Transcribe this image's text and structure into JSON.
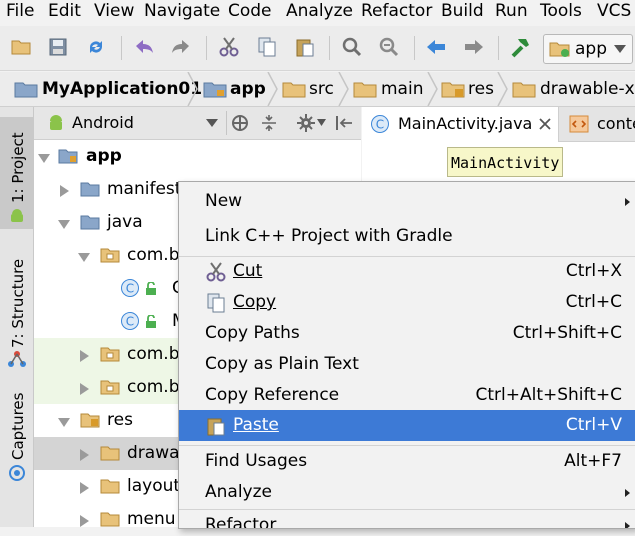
{
  "menubar": {
    "items": [
      "File",
      "Edit",
      "View",
      "Navigate",
      "Code",
      "Analyze",
      "Refactor",
      "Build",
      "Run",
      "Tools",
      "VCS"
    ]
  },
  "toolbar": {
    "icons": [
      "open-folder-icon",
      "save-icon",
      "sync-icon",
      "undo-icon",
      "redo-icon",
      "cut-icon",
      "copy-icon",
      "paste-icon",
      "find-icon",
      "replace-icon",
      "back-icon",
      "forward-icon",
      "build-hammer-icon"
    ],
    "run_config": "app"
  },
  "navbar": {
    "crumbs": [
      "MyApplication01",
      "app",
      "src",
      "main",
      "res",
      "drawable-xh"
    ]
  },
  "tool_strip": {
    "project": "1: Project",
    "structure": "7: Structure",
    "captures": "Captures"
  },
  "project_panel": {
    "view": "Android",
    "tree": [
      {
        "label": "app",
        "depth": 0,
        "state": "open",
        "icon": "module"
      },
      {
        "label": "manifests",
        "depth": 1,
        "state": "closed",
        "icon": "folder"
      },
      {
        "label": "java",
        "depth": 1,
        "state": "open",
        "icon": "folder"
      },
      {
        "label": "com.b",
        "depth": 2,
        "state": "open",
        "icon": "package"
      },
      {
        "label": "C",
        "depth": 3,
        "state": "none",
        "icon": "class"
      },
      {
        "label": "M",
        "depth": 3,
        "state": "none",
        "icon": "class"
      },
      {
        "label": "com.b",
        "depth": 2,
        "state": "closed",
        "icon": "package"
      },
      {
        "label": "com.b",
        "depth": 2,
        "state": "closed",
        "icon": "package"
      },
      {
        "label": "res",
        "depth": 1,
        "state": "open",
        "icon": "res-folder"
      },
      {
        "label": "drawal",
        "depth": 2,
        "state": "closed",
        "icon": "folder"
      },
      {
        "label": "layout",
        "depth": 2,
        "state": "closed",
        "icon": "folder"
      },
      {
        "label": "menu",
        "depth": 2,
        "state": "closed",
        "icon": "folder"
      }
    ]
  },
  "editor": {
    "tabs": [
      "MainActivity.java",
      "conte"
    ],
    "tooltip": "MainActivity"
  },
  "context_menu": {
    "items": [
      {
        "label": "New",
        "shortcut": "",
        "submenu": true
      },
      {
        "label": "Link C++ Project with Gradle",
        "shortcut": ""
      },
      {
        "label": "Cut",
        "shortcut": "Ctrl+X",
        "icon": "cut-icon"
      },
      {
        "label": "Copy",
        "shortcut": "Ctrl+C",
        "icon": "copy-icon"
      },
      {
        "label": "Copy Paths",
        "shortcut": "Ctrl+Shift+C"
      },
      {
        "label": "Copy as Plain Text",
        "shortcut": ""
      },
      {
        "label": "Copy Reference",
        "shortcut": "Ctrl+Alt+Shift+C"
      },
      {
        "label": "Paste",
        "shortcut": "Ctrl+V",
        "icon": "paste-icon",
        "selected": true
      },
      {
        "label": "Find Usages",
        "shortcut": "Alt+F7"
      },
      {
        "label": "Analyze",
        "shortcut": "",
        "submenu": true
      },
      {
        "label": "Refactor",
        "shortcut": "",
        "submenu": true
      }
    ]
  },
  "colors": {
    "selection": "#3d7ad6",
    "folder": "#8aa6c9",
    "tooltip_bg": "#f7f7c9"
  }
}
